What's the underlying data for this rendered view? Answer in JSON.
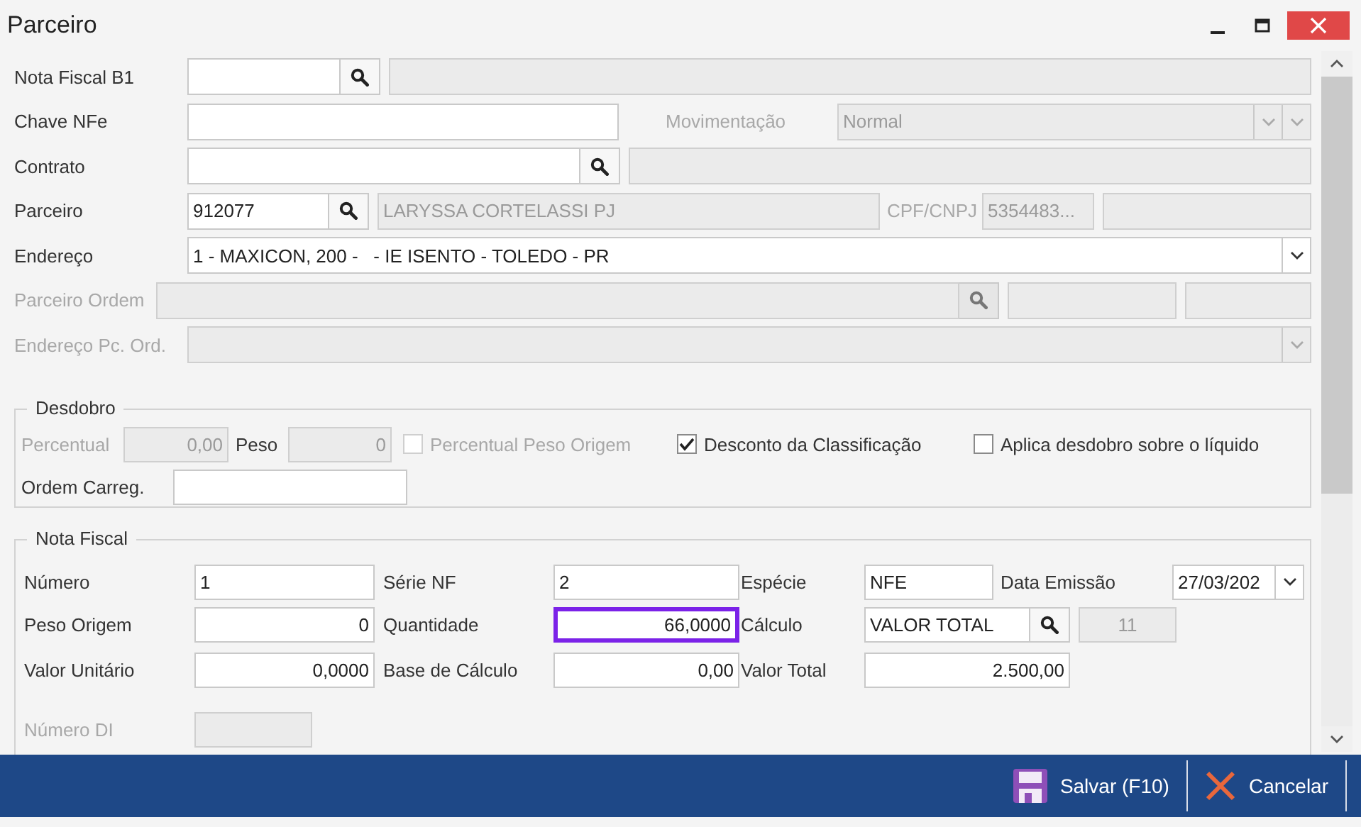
{
  "window": {
    "title": "Parceiro"
  },
  "header_rows": [
    {
      "items": [
        {
          "kind": "label",
          "text": "Nota Fiscal B1",
          "disabled": false
        },
        {
          "kind": "lookup",
          "disabled": false
        },
        {
          "kind": "input",
          "disabled": true
        }
      ]
    },
    {
      "items": [
        {
          "kind": "label",
          "text": "Chave NFe",
          "disabled": false
        },
        {
          "kind": "input",
          "disabled": false
        },
        {
          "kind": "label",
          "text": "Movimentação",
          "disabled": true
        },
        {
          "kind": "double_select",
          "value": "Normal",
          "disabled": true
        }
      ]
    },
    {
      "items": [
        {
          "kind": "label",
          "text": "Contrato",
          "disabled": false
        },
        {
          "kind": "lookup",
          "disabled": false
        },
        {
          "kind": "input",
          "disabled": true
        }
      ]
    },
    {
      "items": [
        {
          "kind": "label",
          "text": "Parceiro",
          "disabled": false
        },
        {
          "kind": "lookup",
          "value": "912077",
          "disabled": false
        },
        {
          "kind": "input",
          "value": "LARYSSA CORTELASSI PJ",
          "disabled": true
        },
        {
          "kind": "label",
          "text": "CPF/CNPJ",
          "disabled": true
        },
        {
          "kind": "input",
          "value": "5354483...",
          "disabled": true
        },
        {
          "kind": "input",
          "disabled": true
        }
      ]
    },
    {
      "items": [
        {
          "kind": "label",
          "text": "Endereço",
          "disabled": false
        },
        {
          "kind": "select",
          "value": "1 - MAXICON, 200 -   - IE ISENTO - TOLEDO - PR",
          "disabled": false
        }
      ]
    },
    {
      "items": [
        {
          "kind": "label",
          "text": "Parceiro Ordem",
          "disabled": true
        },
        {
          "kind": "lookup",
          "disabled": true
        },
        {
          "kind": "input",
          "disabled": true
        },
        {
          "kind": "input",
          "disabled": true
        }
      ]
    },
    {
      "items": [
        {
          "kind": "label",
          "text": "Endereço Pc. Ord.",
          "disabled": true
        },
        {
          "kind": "select",
          "disabled": true
        }
      ]
    }
  ],
  "desdobro": {
    "legend": "Desdobro",
    "rows": [
      {
        "items": [
          {
            "kind": "label",
            "text": "Percentual",
            "disabled": true
          },
          {
            "kind": "input",
            "value": "0,00",
            "disabled": true
          },
          {
            "kind": "label",
            "text": "Peso",
            "disabled": false
          },
          {
            "kind": "input",
            "value": "0",
            "disabled": true
          },
          {
            "kind": "checkbox",
            "label": "Percentual Peso Origem",
            "checked": false,
            "disabled": true
          },
          {
            "kind": "checkbox",
            "label": "Desconto da Classificação",
            "checked": true,
            "disabled": false
          },
          {
            "kind": "checkbox",
            "label": "Aplica desdobro sobre o líquido",
            "checked": false,
            "disabled": false
          }
        ]
      },
      {
        "items": [
          {
            "kind": "label",
            "text": "Ordem Carreg.",
            "disabled": false
          },
          {
            "kind": "input",
            "disabled": false
          }
        ]
      }
    ]
  },
  "nota_fiscal": {
    "legend": "Nota Fiscal",
    "rows": [
      {
        "items": [
          {
            "kind": "label",
            "text": "Número",
            "disabled": false
          },
          {
            "kind": "input",
            "value": "1",
            "disabled": false,
            "focused": false
          },
          {
            "kind": "label",
            "text": "Série NF",
            "disabled": false
          },
          {
            "kind": "input",
            "value": "2",
            "disabled": false,
            "focused": false
          },
          {
            "kind": "label",
            "text": "Espécie",
            "disabled": false
          },
          {
            "kind": "input",
            "value": "NFE",
            "disabled": false,
            "focused": false
          },
          {
            "kind": "label",
            "text": "Data Emissão",
            "disabled": false
          },
          {
            "kind": "select",
            "value": "27/03/202",
            "disabled": false
          }
        ]
      },
      {
        "items": [
          {
            "kind": "label",
            "text": "Peso Origem",
            "disabled": false
          },
          {
            "kind": "input",
            "value": "0",
            "disabled": false,
            "focused": false
          },
          {
            "kind": "label",
            "text": "Quantidade",
            "disabled": false
          },
          {
            "kind": "input",
            "value": "66,0000",
            "disabled": false,
            "focused": true
          },
          {
            "kind": "label",
            "text": "Cálculo",
            "disabled": false
          },
          {
            "kind": "lookup",
            "value": "VALOR TOTAL",
            "disabled": false
          },
          {
            "kind": "input",
            "value": "11",
            "disabled": true,
            "focused": false
          }
        ]
      },
      {
        "items": [
          {
            "kind": "label",
            "text": "Valor Unitário",
            "disabled": false
          },
          {
            "kind": "input",
            "value": "0,0000",
            "disabled": false,
            "focused": false
          },
          {
            "kind": "label",
            "text": "Base de Cálculo",
            "disabled": false
          },
          {
            "kind": "input",
            "value": "0,00",
            "disabled": false,
            "focused": false
          },
          {
            "kind": "label",
            "text": "Valor Total",
            "disabled": false
          },
          {
            "kind": "input",
            "value": "2.500,00",
            "disabled": false,
            "focused": false
          }
        ]
      },
      {
        "items": [
          {
            "kind": "label",
            "text": "Número DI",
            "disabled": true
          },
          {
            "kind": "input",
            "disabled": true,
            "focused": false
          }
        ]
      }
    ]
  },
  "footer_buttons": [
    {
      "kind": "save",
      "label": "Salvar (F10)"
    },
    {
      "kind": "cancel",
      "label": "Cancelar"
    }
  ]
}
